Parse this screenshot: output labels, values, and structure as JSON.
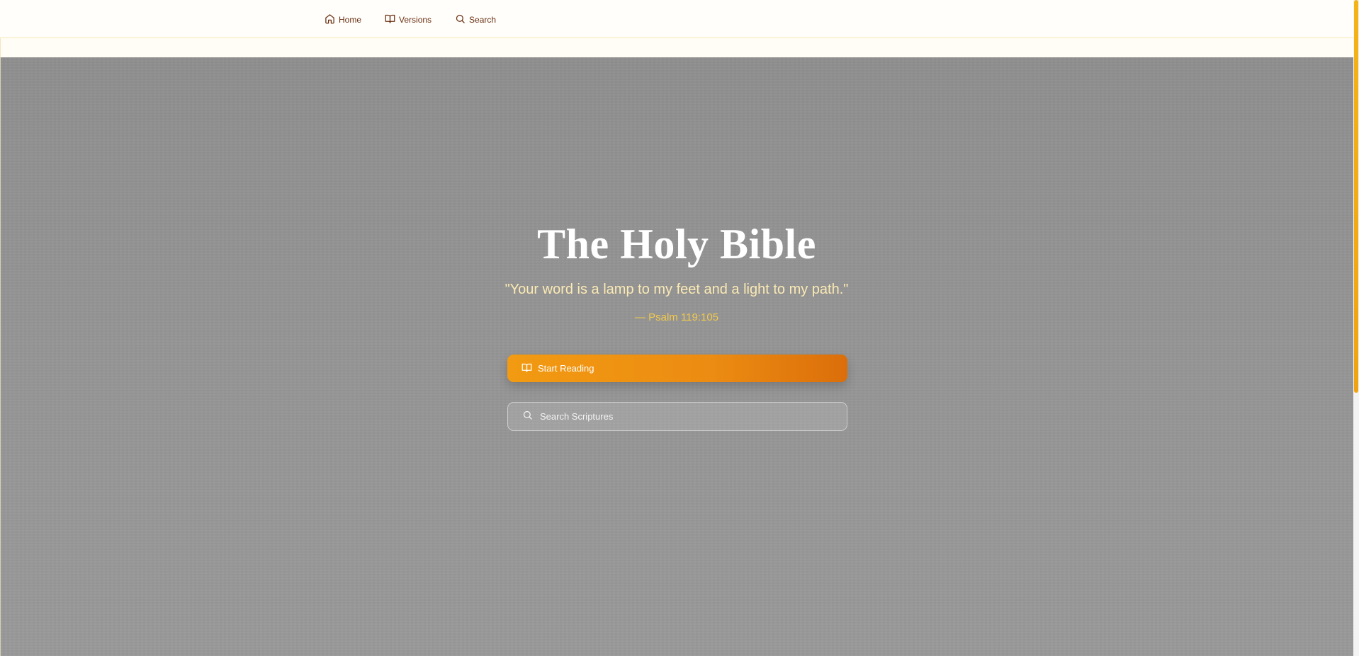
{
  "nav": {
    "items": [
      {
        "label": "Home",
        "icon": "home-icon"
      },
      {
        "label": "Versions",
        "icon": "book-open-icon"
      },
      {
        "label": "Search",
        "icon": "search-icon"
      }
    ]
  },
  "hero": {
    "title": "The Holy Bible",
    "quote": "\"Your word is a lamp to my feet and a light to my path.\"",
    "reference": "— Psalm 119:105",
    "start_button": {
      "label": "Start Reading",
      "icon": "book-open-icon"
    },
    "search": {
      "placeholder": "Search Scriptures",
      "value": "",
      "icon": "search-icon"
    }
  },
  "colors": {
    "nav_text": "#6b2f12",
    "accent": "#f29a12",
    "accent_dark": "#db6e0a",
    "quote": "#fbeab4",
    "reference": "#f2c94c"
  }
}
